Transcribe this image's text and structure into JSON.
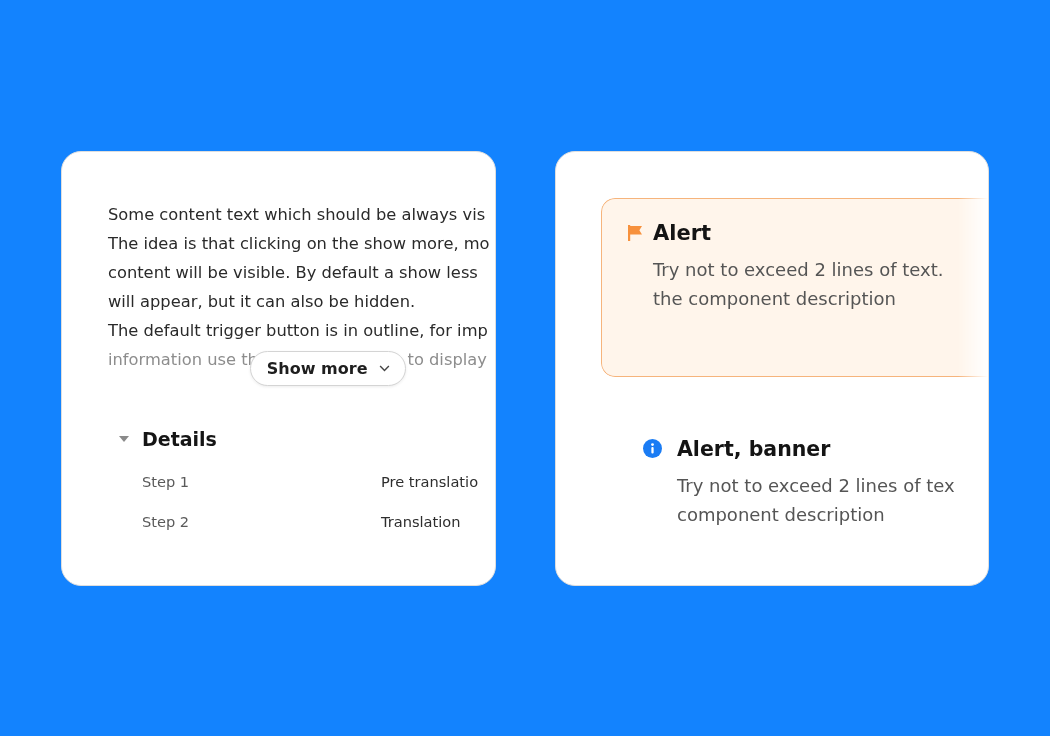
{
  "show_more_panel": {
    "content_lines": [
      "Some content text which should be always vis",
      "The idea is that clicking on the show more, mo",
      "content will be visible. By default a show less",
      "will appear, but it can also be hidden.",
      "The default trigger button is in outline, for imp"
    ],
    "faded_line": {
      "before_button": "information use th",
      "after_button": "to display"
    },
    "show_more_button": {
      "label": "Show more"
    },
    "details": {
      "title": "Details",
      "expanded": true,
      "rows": [
        {
          "label": "Step 1",
          "value": "Pre translatio"
        },
        {
          "label": "Step 2",
          "value": "Translation"
        }
      ]
    }
  },
  "alerts_panel": {
    "alerts": [
      {
        "kind": "warning",
        "title": "Alert",
        "lines": [
          "Try not to exceed 2 lines of text.",
          "the component description"
        ]
      },
      {
        "kind": "info",
        "title": "Alert, banner",
        "lines": [
          "Try not to exceed 2 lines of tex",
          "component description"
        ]
      }
    ]
  }
}
